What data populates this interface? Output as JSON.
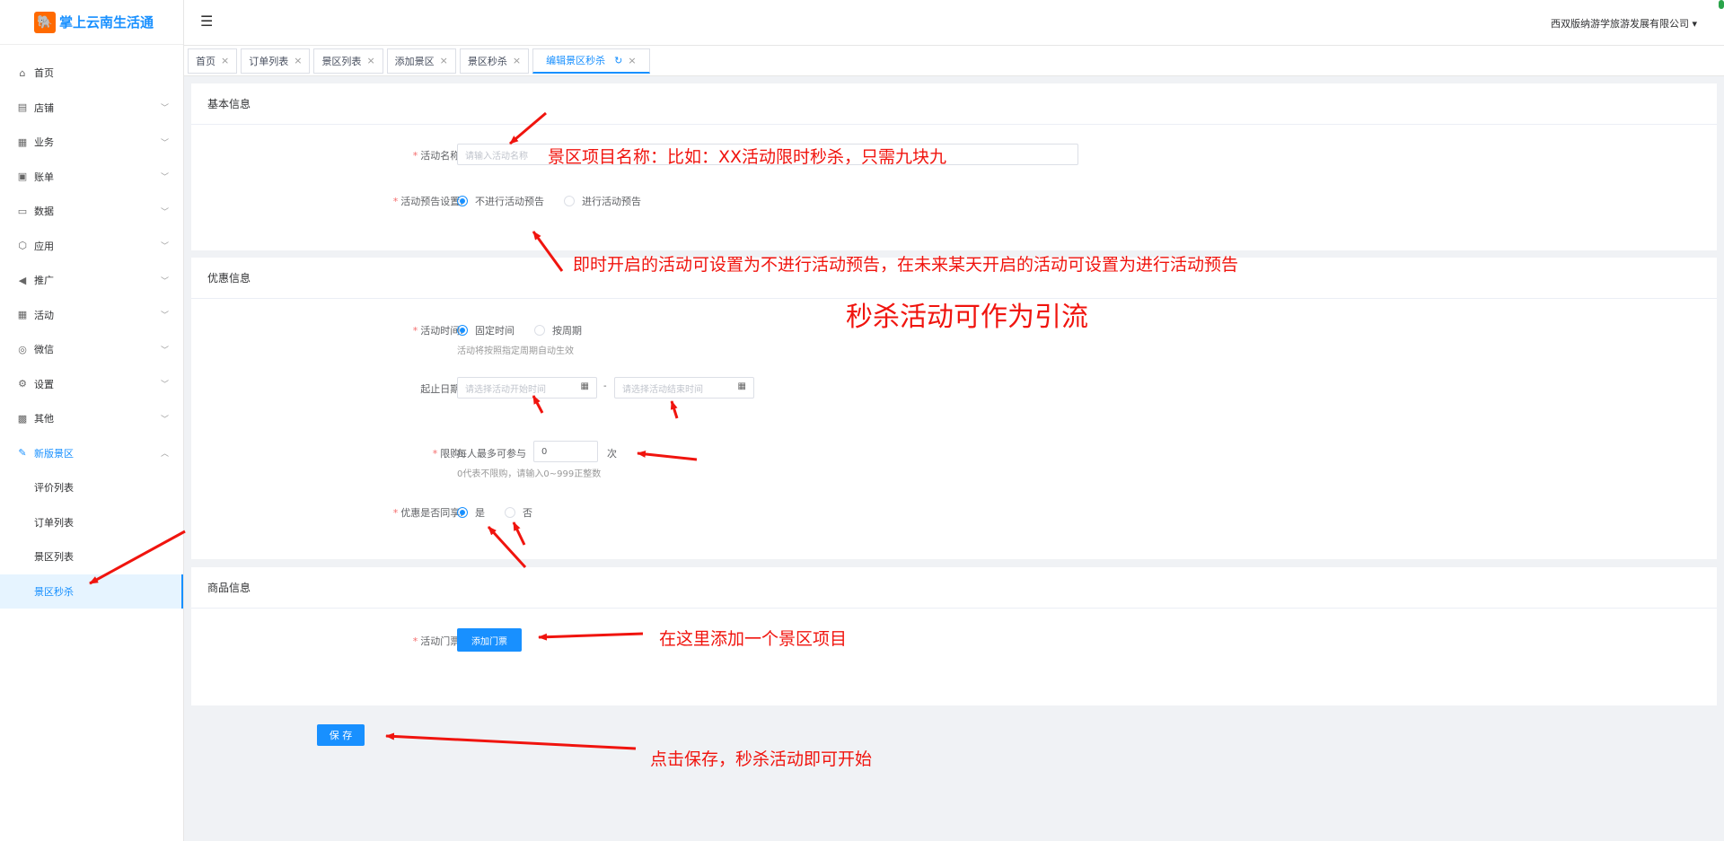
{
  "app": {
    "title": "掌上云南生活通",
    "company": "西双版纳游学旅游发展有限公司"
  },
  "sidebar": {
    "menu": [
      {
        "label": "首页",
        "icon": "home-icon",
        "glyph": "⌂",
        "has_children": false
      },
      {
        "label": "店铺",
        "icon": "store-icon",
        "glyph": "▤",
        "has_children": true
      },
      {
        "label": "业务",
        "icon": "business-icon",
        "glyph": "▦",
        "has_children": true
      },
      {
        "label": "账单",
        "icon": "bill-icon",
        "glyph": "▣",
        "has_children": true
      },
      {
        "label": "数据",
        "icon": "data-icon",
        "glyph": "▭",
        "has_children": true
      },
      {
        "label": "应用",
        "icon": "app-icon",
        "glyph": "⬡",
        "has_children": true
      },
      {
        "label": "推广",
        "icon": "promotion-icon",
        "glyph": "◀",
        "has_children": true
      },
      {
        "label": "活动",
        "icon": "activity-icon",
        "glyph": "▦",
        "has_children": true
      },
      {
        "label": "微信",
        "icon": "wechat-icon",
        "glyph": "◎",
        "has_children": true
      },
      {
        "label": "设置",
        "icon": "settings-icon",
        "glyph": "⚙",
        "has_children": true
      },
      {
        "label": "其他",
        "icon": "grid-icon",
        "glyph": "▩",
        "has_children": true
      },
      {
        "label": "新版景区",
        "icon": "scenic-icon",
        "glyph": "✎",
        "has_children": true,
        "open": true
      }
    ],
    "submenu": [
      {
        "label": "评价列表",
        "active": false
      },
      {
        "label": "订单列表",
        "active": false
      },
      {
        "label": "景区列表",
        "active": false
      },
      {
        "label": "景区秒杀",
        "active": true
      }
    ]
  },
  "tabs": [
    {
      "label": "首页"
    },
    {
      "label": "订单列表"
    },
    {
      "label": "景区列表"
    },
    {
      "label": "添加景区"
    },
    {
      "label": "景区秒杀"
    },
    {
      "label": "编辑景区秒杀",
      "active": true
    }
  ],
  "form": {
    "basic": {
      "title": "基本信息",
      "name_label": "活动名称:",
      "name_placeholder": "请输入活动名称",
      "preview_label": "活动预告设置:",
      "preview_options": [
        "不进行活动预告",
        "进行活动预告"
      ]
    },
    "discount": {
      "title": "优惠信息",
      "time_label": "活动时间:",
      "time_options": [
        "固定时间",
        "按周期"
      ],
      "time_hint": "活动将按照指定周期自动生效",
      "date_label": "起止日期:",
      "start_placeholder": "请选择活动开始时间",
      "end_placeholder": "请选择活动结束时间",
      "date_separator": "-",
      "limit_label": "限购:",
      "limit_prefix": "每人最多可参与",
      "limit_value": "0",
      "limit_suffix": "次",
      "limit_hint": "0代表不限购，请输入0~999正整数",
      "share_label": "优惠是否同享:",
      "share_options": [
        "是",
        "否"
      ]
    },
    "goods": {
      "title": "商品信息",
      "ticket_label": "活动门票:",
      "add_ticket_button": "添加门票"
    },
    "save_button": "保 存"
  },
  "annotations": {
    "name_note": "景区项目名称：比如：XX活动限时秒杀，只需九块九",
    "preview_note": "即时开启的活动可设置为不进行活动预告，在未来某天开启的活动可设置为进行活动预告",
    "flash_note": "秒杀活动可作为引流",
    "ticket_note": "在这里添加一个景区项目",
    "save_note": "点击保存，秒杀活动即可开始"
  },
  "colors": {
    "primary": "#1890ff",
    "annotation": "#f0140e",
    "required": "#f56c6c"
  }
}
